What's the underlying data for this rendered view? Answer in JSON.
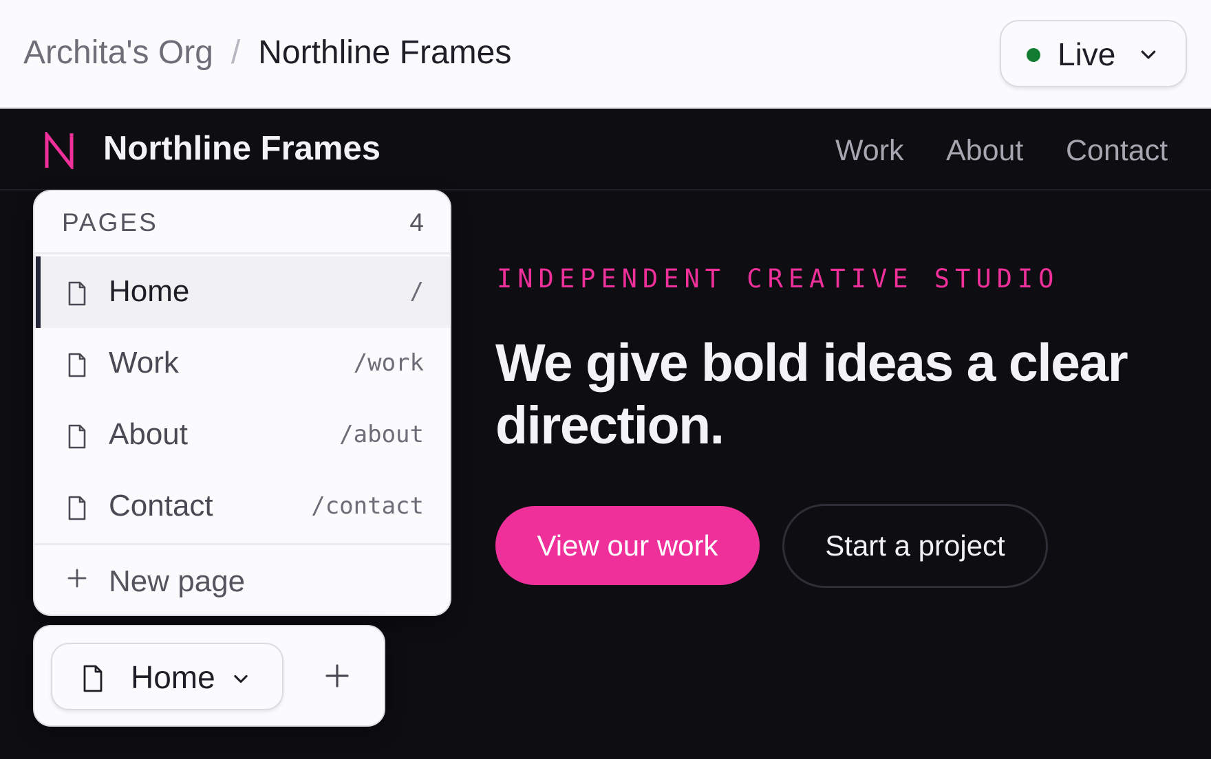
{
  "topbar": {
    "org": "Archita's Org",
    "separator": "/",
    "site": "Northline Frames",
    "status": {
      "label": "Live",
      "dot_color": "#127c32"
    }
  },
  "site": {
    "logo_icon": "n-logo-icon",
    "name": "Northline Frames",
    "nav": [
      "Work",
      "About",
      "Contact"
    ],
    "hero": {
      "eyebrow": "INDEPENDENT CREATIVE STUDIO",
      "headline": "We give bold ideas a clear direction.",
      "primary_cta": "View our work",
      "secondary_cta": "Start a project"
    },
    "accent_color": "#f0309a",
    "background_color": "#0e0e12"
  },
  "pages_panel": {
    "title": "PAGES",
    "count": "4",
    "pages": [
      {
        "name": "Home",
        "path": "/",
        "active": true
      },
      {
        "name": "Work",
        "path": "/work",
        "active": false
      },
      {
        "name": "About",
        "path": "/about",
        "active": false
      },
      {
        "name": "Contact",
        "path": "/contact",
        "active": false
      }
    ],
    "new_page_label": "New page"
  },
  "switcher": {
    "current_page": "Home",
    "add_icon": "plus-icon"
  }
}
